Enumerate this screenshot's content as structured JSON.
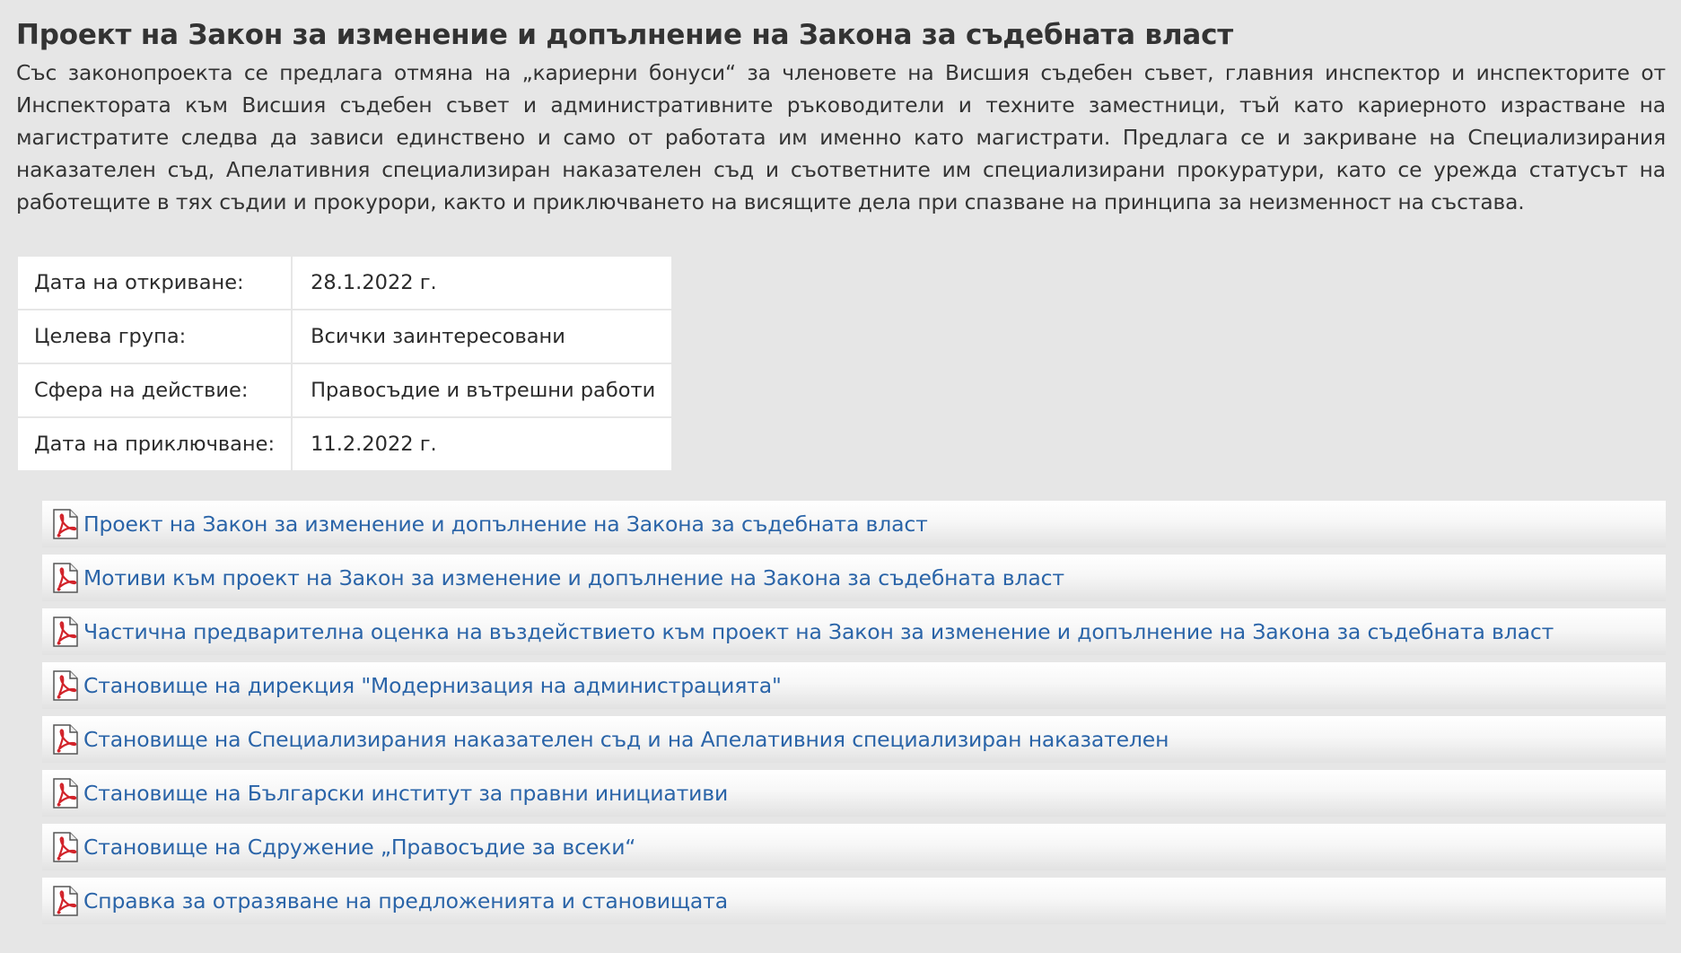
{
  "title": "Проект на Закон за изменение и допълнение на Закона за съдебната власт",
  "intro": "Със законопроекта се предлага отмяна на „кариерни бонуси“ за членовете на Висшия съдебен съвет, главния инспектор и инспекторите от Инспектората към Висшия съдебен съвет и административните ръководители и техните заместници, тъй като кариерното израстване на магистратите следва да зависи единствено и само от работата им именно като магистрати. Предлага се и закриване на Специализирания наказателен съд, Апелативния специализиран наказателен съд и съответните им специализирани прокуратури, като се урежда статусът на работещите в тях съдии и прокурори, както и приключването на висящите дела при спазване на принципа за неизменност на състава.",
  "meta": [
    {
      "key": "Дата на откриване:",
      "value": "28.1.2022 г."
    },
    {
      "key": "Целева група:",
      "value": "Всички заинтересовани"
    },
    {
      "key": "Сфера на действие:",
      "value": "Правосъдие и вътрешни работи"
    },
    {
      "key": "Дата на приключване:",
      "value": "11.2.2022 г."
    }
  ],
  "documents": [
    {
      "label": "Проект на Закон за изменение и допълнение на Закона за съдебната власт",
      "icon": "pdf-icon"
    },
    {
      "label": "Мотиви към проект на Закон за изменение и допълнение на Закона за съдебната власт",
      "icon": "pdf-icon"
    },
    {
      "label": "Частична предварителна оценка на въздействието към проект на Закон за изменение и допълнение на Закона за съдебната власт",
      "icon": "pdf-icon"
    },
    {
      "label": "Становище на дирекция \"Модернизация на администрацията\"",
      "icon": "pdf-icon"
    },
    {
      "label": "Становище на Специализирания наказателен съд и на Апелативния специализиран наказателен",
      "icon": "pdf-icon"
    },
    {
      "label": "Становище на Български институт за правни инициативи",
      "icon": "pdf-icon"
    },
    {
      "label": "Становище на Сдружение „Правосъдие за всеки“",
      "icon": "pdf-icon"
    },
    {
      "label": "Справка за отразяване на предложенията и становищата",
      "icon": "pdf-icon"
    }
  ],
  "colors": {
    "background": "#e6e6e6",
    "link": "#2a64a8",
    "pdf_red": "#d2232a"
  }
}
